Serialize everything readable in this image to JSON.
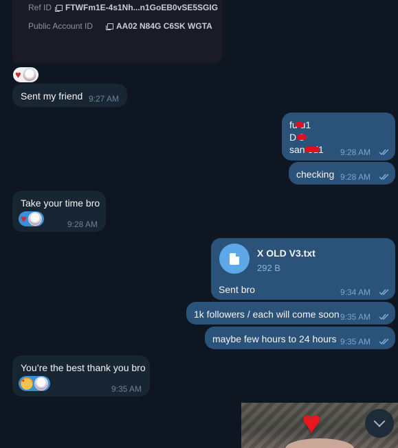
{
  "card": {
    "ref_label": "Ref ID",
    "ref_value": "FTWFm1E-4s1Nh...n1GoEB0vSE5SGIG",
    "public_label": "Public Account ID",
    "public_value": "AA02 N84G C6SK WGTA"
  },
  "messages": [
    {
      "id": "m1",
      "dir": "in",
      "text": "Sent my friend",
      "time": "9:27 AM"
    },
    {
      "id": "m2",
      "dir": "out",
      "lines": [
        "fu  u1",
        "D   8",
        "san     ed1"
      ],
      "time": "9:28 AM"
    },
    {
      "id": "m3",
      "dir": "out",
      "text": "checking",
      "time": "9:28 AM"
    },
    {
      "id": "m4",
      "dir": "in",
      "text": "Take your time bro",
      "time": "9:28 AM"
    },
    {
      "id": "m5",
      "dir": "out",
      "file_name": "X OLD V3.txt",
      "file_size": "292 B",
      "text": "Sent bro",
      "time": "9:34 AM"
    },
    {
      "id": "m6",
      "dir": "out",
      "text": "1k followers / each will come soon",
      "time": "9:35 AM"
    },
    {
      "id": "m7",
      "dir": "out",
      "text": "maybe few hours to 24 hours",
      "time": "9:35 AM"
    },
    {
      "id": "m8",
      "dir": "in",
      "text": "You’re the best thank you bro",
      "time": "9:35 AM"
    }
  ],
  "icons": {
    "copy": "copy-icon",
    "read_receipt": "double-check-icon",
    "file": "document-icon",
    "scroll_down": "chevron-down-icon"
  },
  "colors": {
    "background": "#0e1621",
    "incoming": "#182533",
    "outgoing": "#2b5278",
    "accent": "#5fa8e8"
  }
}
